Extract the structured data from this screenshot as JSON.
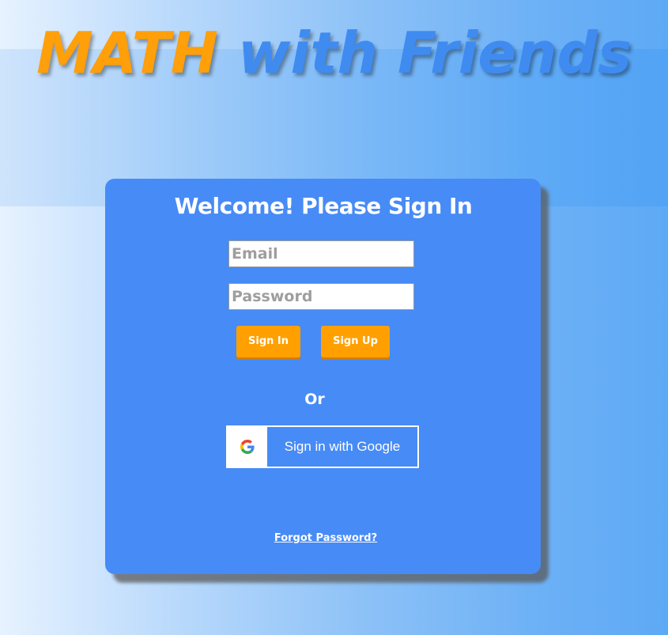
{
  "app": {
    "title_part1": "MATH",
    "title_part2": "with Friends"
  },
  "login": {
    "heading": "Welcome! Please Sign In",
    "email": {
      "placeholder": "Email",
      "value": ""
    },
    "password": {
      "placeholder": "Password",
      "value": ""
    },
    "signin_label": "Sign In",
    "signup_label": "Sign Up",
    "or_label": "Or",
    "google_label": "Sign in with Google",
    "google_icon": "google-g-logo",
    "forgot_label": "Forgot Password?"
  },
  "colors": {
    "accent_orange": "#ffa000",
    "title_blue": "#3f8bf0",
    "card_blue": "#478bf6"
  }
}
